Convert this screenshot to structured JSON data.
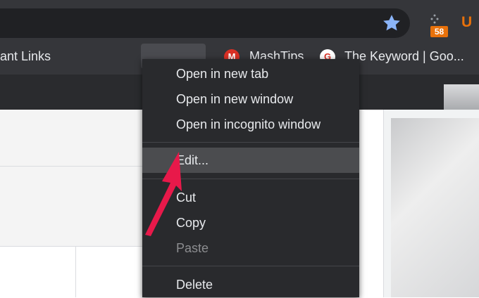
{
  "bookmarks_bar": {
    "items": [
      {
        "label": "ant Links"
      },
      {
        "label": "MashTips"
      },
      {
        "label": "The Keyword | Goo..."
      }
    ]
  },
  "extension": {
    "badge": "58"
  },
  "context_menu": {
    "open_new_tab": "Open in new tab",
    "open_new_window": "Open in new window",
    "open_incognito": "Open in incognito window",
    "edit": "Edit...",
    "cut": "Cut",
    "copy": "Copy",
    "paste": "Paste",
    "delete": "Delete"
  },
  "colors": {
    "menu_background": "#292a2d",
    "highlight": "#4b4c4f",
    "arrow": "#e8194a",
    "star": "#8ab4f8",
    "badge": "#e8710a"
  },
  "icons": {
    "star": "star-icon",
    "extension": "extension-icon",
    "arrow": "arrow-icon"
  }
}
